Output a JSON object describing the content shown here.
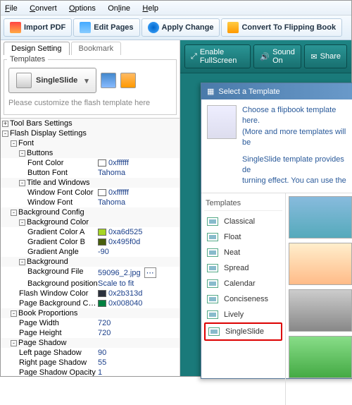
{
  "menu": {
    "file": "File",
    "convert": "Convert",
    "options": "Options",
    "online": "Online",
    "help": "Help"
  },
  "toolbar": {
    "import": "Import PDF",
    "edit": "Edit Pages",
    "apply": "Apply Change",
    "convert": "Convert To Flipping Book"
  },
  "tabs": {
    "design": "Design Setting",
    "bookmark": "Bookmark"
  },
  "templates": {
    "legend": "Templates",
    "name": "SingleSlide",
    "hint": "Please customize the flash template here"
  },
  "tree": {
    "toolbars": "Tool Bars Settings",
    "flash": "Flash Display Settings",
    "font": "Font",
    "buttons": "Buttons",
    "fontcolor_k": "Font Color",
    "fontcolor_v": "0xffffff",
    "buttonfont_k": "Button Font",
    "buttonfont_v": "Tahoma",
    "titlewin": "Title and Windows",
    "winfontcolor_k": "Window Font Color",
    "winfontcolor_v": "0xffffff",
    "winfont_k": "Window Font",
    "winfont_v": "Tahoma",
    "bgconfig": "Background Config",
    "bgcolor": "Background Color",
    "gradA_k": "Gradient Color A",
    "gradA_v": "0xa6d525",
    "gradB_k": "Gradient Color B",
    "gradB_v": "0x495f0d",
    "gradAngle_k": "Gradient Angle",
    "gradAngle_v": "-90",
    "bg": "Background",
    "bgfile_k": "Background File",
    "bgfile_v": "59096_2.jpg",
    "bgpos_k": "Background position",
    "bgpos_v": "Scale to fit",
    "flashwin_k": "Flash Window Color",
    "flashwin_v": "0x2b313d",
    "pagebg_k": "Page Background Color",
    "pagebg_v": "0x008040",
    "bookprop": "Book Proportions",
    "pagew_k": "Page Width",
    "pagew_v": "720",
    "pageh_k": "Page Height",
    "pageh_v": "720",
    "pageshadow": "Page Shadow",
    "leftsh_k": "Left page Shadow",
    "leftsh_v": "90",
    "rightsh_k": "Right page Shadow",
    "rightsh_v": "55",
    "pagesho_k": "Page Shadow Opacity",
    "pagesho_v": "1"
  },
  "rightbar": {
    "fullscreen": "Enable FullScreen",
    "sound": "Sound On",
    "share": "Share"
  },
  "dialog": {
    "title": "Select a Template",
    "desc1": "Choose a flipbook template here.",
    "desc2": "(More and more templates will be",
    "desc3": "SingleSlide template provides de",
    "desc4": "turning effect. You can use the",
    "list_head": "Templates",
    "items": [
      "Classical",
      "Float",
      "Neat",
      "Spread",
      "Calendar",
      "Conciseness",
      "Lively",
      "SingleSlide"
    ]
  },
  "colors": {
    "gradA": "#a6d525",
    "gradB": "#495f0d",
    "flashwin": "#2b313d",
    "pagebg": "#008040",
    "white": "#ffffff"
  }
}
